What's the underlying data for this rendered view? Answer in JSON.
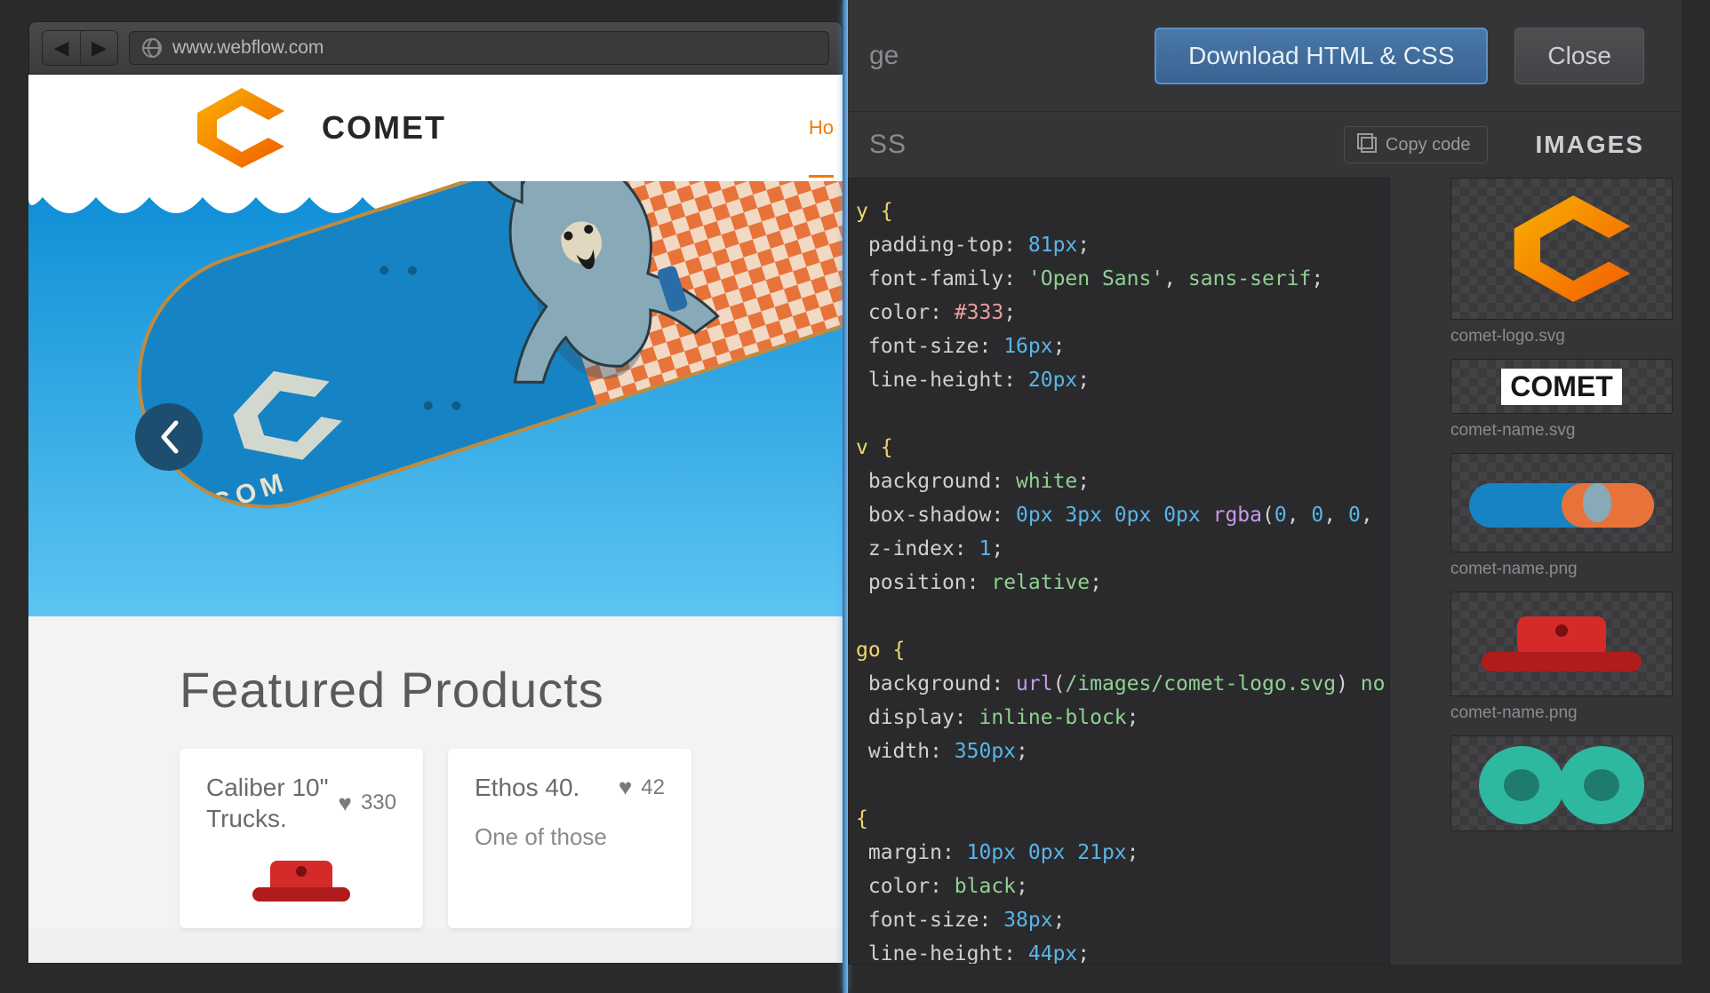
{
  "browser": {
    "url": "www.webflow.com"
  },
  "site": {
    "brand": "COMET",
    "nav_home": "Ho",
    "featured_heading": "Featured Products",
    "products": [
      {
        "title": "Caliber 10\"\nTrucks.",
        "likes": "330",
        "desc": ""
      },
      {
        "title": "Ethos 40.",
        "likes": "42",
        "desc": "One of those"
      }
    ]
  },
  "panel": {
    "page_tab": "ge",
    "download": "Download HTML & CSS",
    "close": "Close",
    "css_tab": "SS",
    "copy": "Copy code",
    "images_label": "IMAGES"
  },
  "code": {
    "l1": "y {",
    "l2a": "padding-top: ",
    "l2b": "81px",
    "l2c": ";",
    "l3a": "font-family: ",
    "l3b": "'Open Sans'",
    "l3c": ", ",
    "l3d": "sans-serif",
    "l3e": ";",
    "l4a": "color: ",
    "l4b": "#333",
    "l4c": ";",
    "l5a": "font-size: ",
    "l5b": "16px",
    "l5c": ";",
    "l6a": "line-height: ",
    "l6b": "20px",
    "l6c": ";",
    "l7": "",
    "l8": "v {",
    "l9a": "background: ",
    "l9b": "white",
    "l9c": ";",
    "l10a": "box-shadow: ",
    "l10b": "0px 3px 0px 0px ",
    "l10c": "rgba",
    "l10d": "(",
    "l10e": "0",
    "l10f": ", ",
    "l10g": "0",
    "l10h": ", ",
    "l10i": "0",
    "l10j": ",",
    "l11a": "z-index: ",
    "l11b": "1",
    "l11c": ";",
    "l12a": "position: ",
    "l12b": "relative",
    "l12c": ";",
    "l13": "",
    "l14": "go {",
    "l15a": "background: ",
    "l15b": "url",
    "l15c": "(",
    "l15d": "/images/comet-logo.svg",
    "l15e": ") ",
    "l15f": "no",
    "l16a": "display: ",
    "l16b": "inline-block",
    "l16c": ";",
    "l17a": "width: ",
    "l17b": "350px",
    "l17c": ";",
    "l18": "",
    "l19": "{",
    "l20a": "margin: ",
    "l20b": "10px 0px 21px",
    "l20c": ";",
    "l21a": "color: ",
    "l21b": "black",
    "l21c": ";",
    "l22a": "font-size: ",
    "l22b": "38px",
    "l22c": ";",
    "l23a": "line-height: ",
    "l23b": "44px",
    "l23c": ";"
  },
  "images": [
    {
      "caption": "comet-logo.svg"
    },
    {
      "caption": "comet-name.svg"
    },
    {
      "caption": "comet-name.png"
    },
    {
      "caption": "comet-name.png"
    },
    {
      "caption": ""
    }
  ]
}
